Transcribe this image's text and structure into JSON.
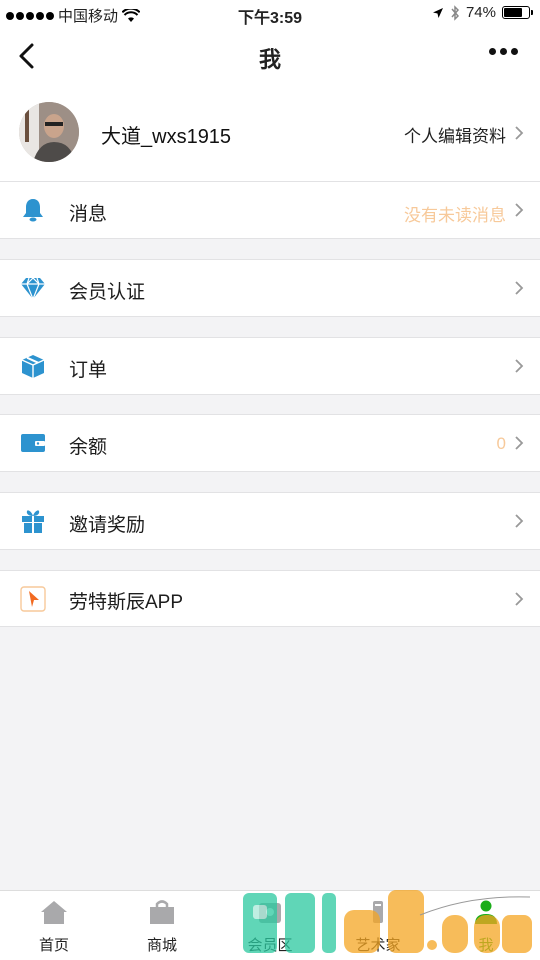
{
  "status_bar": {
    "carrier": "中国移动",
    "time": "下午3:59",
    "battery_percent": 74,
    "battery_label": "74%"
  },
  "nav": {
    "title": "我"
  },
  "profile": {
    "name": "大道_wxs1915",
    "edit_label": "个人编辑资料"
  },
  "menu": {
    "messages": {
      "label": "消息",
      "value": "没有未读消息",
      "icon": "bell-icon"
    },
    "membership": {
      "label": "会员认证",
      "icon": "diamond-icon"
    },
    "orders": {
      "label": "订单",
      "icon": "box-icon"
    },
    "balance": {
      "label": "余额",
      "value": "0",
      "icon": "wallet-icon"
    },
    "invite": {
      "label": "邀请奖励",
      "icon": "gift-icon"
    },
    "app": {
      "label": "劳特斯辰APP",
      "icon": "app-logo-icon"
    }
  },
  "tabs": [
    {
      "label": "首页",
      "icon": "home-icon"
    },
    {
      "label": "商城",
      "icon": "shop-bag-icon"
    },
    {
      "label": "会员区",
      "icon": "member-icon"
    },
    {
      "label": "艺术家",
      "icon": "artist-icon"
    },
    {
      "label": "我",
      "icon": "person-icon",
      "active": true
    }
  ],
  "colors": {
    "accent_blue": "#2d93cf",
    "value_orange": "#f7c99a",
    "active_tab_green": "#1aad19"
  }
}
